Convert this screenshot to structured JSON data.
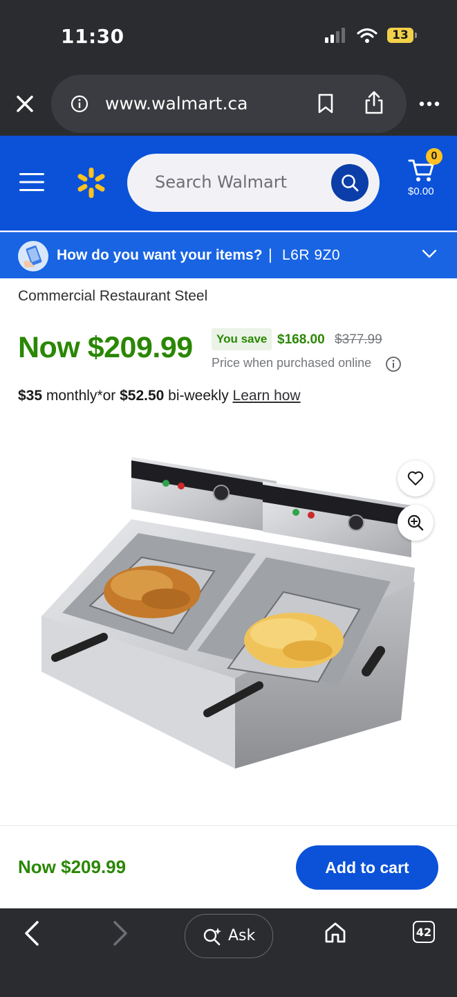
{
  "status_bar": {
    "time": "11:30",
    "battery": "13"
  },
  "browser": {
    "url": "www.walmart.ca"
  },
  "header": {
    "search_placeholder": "Search Walmart",
    "cart_count": "0",
    "cart_total": "$0.00",
    "brand_color": "#0b52d9"
  },
  "fulfillment": {
    "question": "How do you want your items?",
    "separator": "|",
    "postal_code": "L6R 9Z0"
  },
  "product": {
    "title_partial": "Commercial Restaurant Steel",
    "now_price": "Now $209.99",
    "save_label": "You save",
    "save_amount": "$168.00",
    "was_price": "$377.99",
    "price_note": "Price when purchased online",
    "financing": {
      "monthly_amount": "$35",
      "monthly_text": " monthly*or ",
      "biweekly_amount": "$52.50",
      "biweekly_text": " bi-weekly ",
      "learn_link": "Learn how"
    },
    "image_alt_icon": "deep-fryer-image"
  },
  "sticky": {
    "price": "Now $209.99",
    "add_to_cart": "Add to cart"
  },
  "bottom_nav": {
    "ask_label": "Ask",
    "tab_count": "42"
  },
  "colors": {
    "price_green": "#2a8703",
    "walmart_blue": "#0b52d9",
    "spark_yellow": "#ffc220"
  }
}
